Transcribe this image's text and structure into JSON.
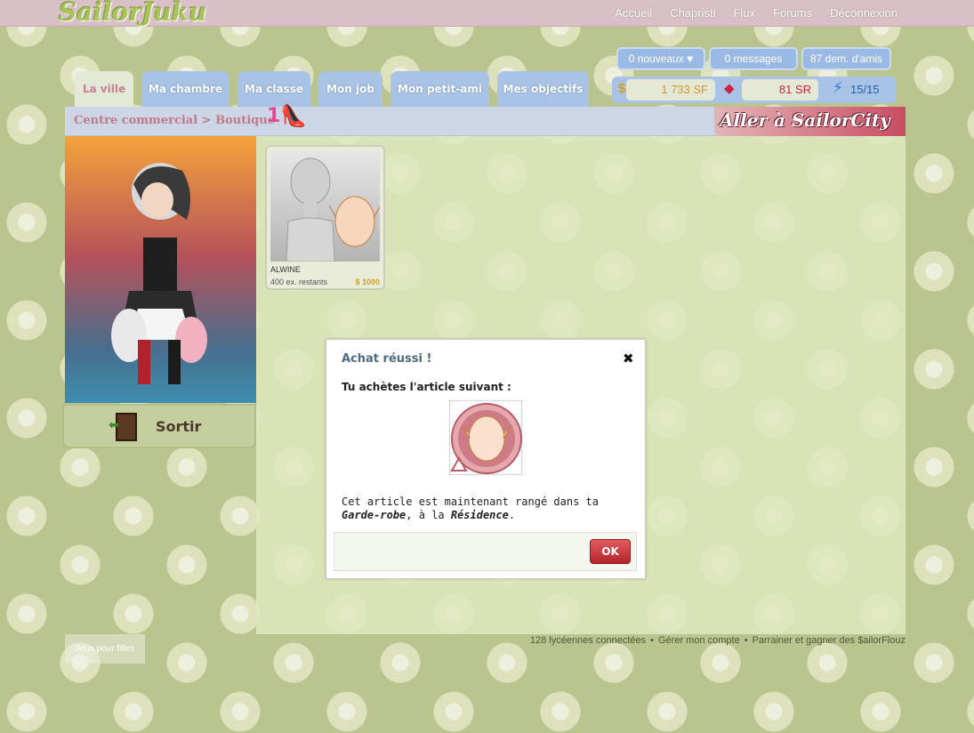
{
  "brand": {
    "logo": "SailorJuku"
  },
  "topnav": {
    "items": [
      "Accueil",
      "Chapristi",
      "Flux",
      "Forums",
      "Déconnexion"
    ]
  },
  "notifications": {
    "nouveaux": "0 nouveaux ♥",
    "messages": "0 messages",
    "friends": "87 dem. d'amis"
  },
  "tabs": [
    "La ville",
    "Ma chambre",
    "Ma classe",
    "Mon job",
    "Mon petit-ami",
    "Mes objectifs"
  ],
  "active_tab": "La ville",
  "resources": {
    "sf": "1 733 SF",
    "sr": "81 SR",
    "energy": "15/15"
  },
  "breadcrumb": {
    "text": "Centre commercial > Boutique",
    "count": "1"
  },
  "sailorcity": {
    "label": "Aller à SailorCity"
  },
  "sortir": {
    "label": "Sortir"
  },
  "shop_item": {
    "name": "ALWINE",
    "stock": "400 ex. restants",
    "price": "$ 1000"
  },
  "modal": {
    "title": "Achat réussi !",
    "subtitle": "Tu achètes l'article suivant :",
    "msg_before": "Cet article est maintenant rangé dans ta ",
    "msg_garde": "Garde-robe",
    "msg_mid": ", à la ",
    "msg_residence": "Résidence",
    "msg_end": ".",
    "ok": "OK"
  },
  "footer": {
    "online": "128 lycéennes connectées",
    "account": "Gérer mon compte",
    "sponsor": "Parrainer et gagner des $ailorFlouz",
    "jeux": "Jeux pour filles"
  },
  "colors": {
    "accent": "#c97f94",
    "tab_blue": "#a9c3e6",
    "ok_red": "#c53a3f"
  }
}
